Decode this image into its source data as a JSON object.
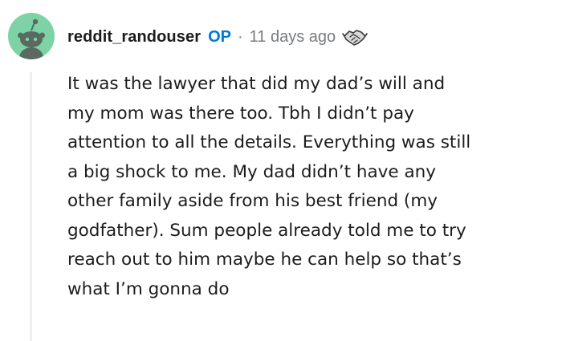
{
  "comment": {
    "author": "reddit_randouser",
    "op_badge": "OP",
    "separator": "·",
    "timestamp": "11 days ago",
    "award_icon": "handshake-award-icon",
    "avatar_icon": "snoo-avatar-icon",
    "body": "It was the lawyer that did my dad’s will and\nmy mom was there too. Tbh I didn’t pay\nattention to all the details. Everything was still\na big shock to me. My dad didn’t have any\nother family aside from his best friend (my\ngodfather). Sum people already told me to try\nreach out to him maybe he can help so that’s\nwhat I’m gonna do"
  },
  "colors": {
    "avatar_bg": "#7ed3a6",
    "op_badge": "#0079d3",
    "meta_text": "#787c7e",
    "body_text": "#1c1c1c",
    "thread_line": "#edeff1"
  }
}
